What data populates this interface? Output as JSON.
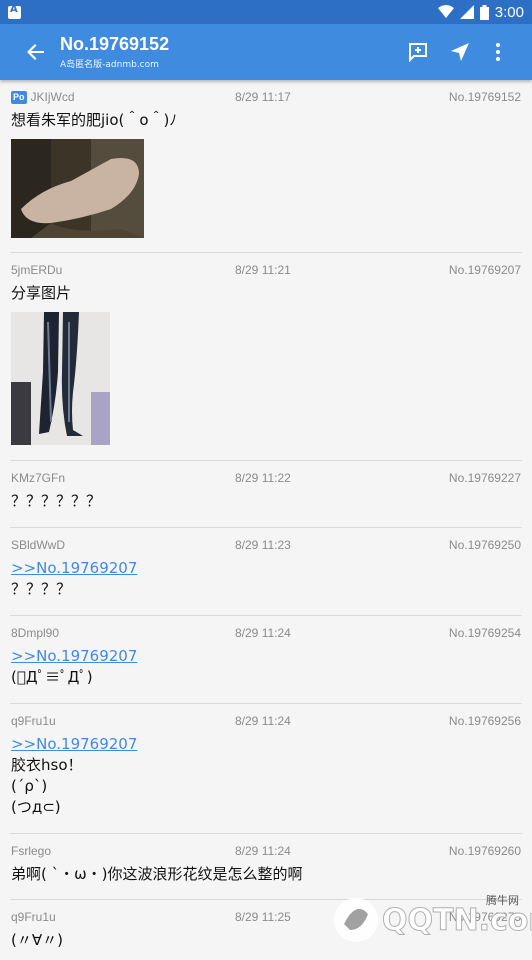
{
  "status": {
    "time": "3:00"
  },
  "toolbar": {
    "title": "No.19769152",
    "subtitle": "A岛匿名版-adnmb.com"
  },
  "posts": [
    {
      "uid": "JKIjWcd",
      "po": "Po",
      "date": "8/29 11:17",
      "no": "No.19769152",
      "ref": "",
      "lines": [
        "想看朱军的肥jio(＾o＾)ﾉ"
      ],
      "image": "foot"
    },
    {
      "uid": "5jmERDu",
      "date": "8/29 11:21",
      "no": "No.19769207",
      "ref": "",
      "lines": [
        "分享图片"
      ],
      "image": "legs"
    },
    {
      "uid": "KMz7GFn",
      "date": "8/29 11:22",
      "no": "No.19769227",
      "ref": "",
      "lines": [
        "？？？？？？"
      ]
    },
    {
      "uid": "SBldWwD",
      "date": "8/29 11:23",
      "no": "No.19769250",
      "ref": ">>No.19769207",
      "lines": [
        "？？？？"
      ]
    },
    {
      "uid": "8Dmpl90",
      "date": "8/29 11:24",
      "no": "No.19769254",
      "ref": ">>No.19769207",
      "lines": [
        "(ﾟДﾟ≡ﾟДﾟ)"
      ]
    },
    {
      "uid": "q9Fru1u",
      "date": "8/29 11:24",
      "no": "No.19769256",
      "ref": ">>No.19769207",
      "lines": [
        "胶衣hso！",
        "(´ρ`)",
        "(つд⊂)"
      ]
    },
    {
      "uid": "Fsrlego",
      "date": "8/29 11:24",
      "no": "No.19769260",
      "ref": "",
      "lines": [
        "弟啊( `・ω・)你这波浪形花纹是怎么整的啊"
      ]
    },
    {
      "uid": "q9Fru1u",
      "date": "8/29 11:25",
      "no": "No.19769275",
      "ref": "",
      "lines": [
        "(〃∀〃)"
      ]
    }
  ],
  "watermark": {
    "text": "QQTN.com",
    "label": "腾牛网"
  },
  "colors": {
    "primary": "#3f8be0",
    "statusbar": "#2e6fc6"
  }
}
